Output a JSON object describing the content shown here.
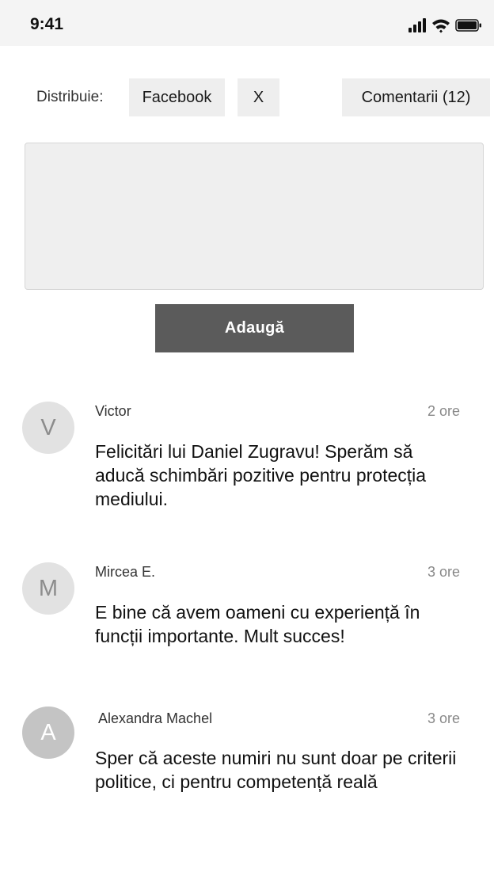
{
  "status_bar": {
    "time": "9:41",
    "icons": [
      "signal-icon",
      "wifi-icon",
      "battery-icon"
    ]
  },
  "share": {
    "label": "Distribuie:",
    "facebook": "Facebook",
    "x": "X",
    "comments": "Comentarii (12)"
  },
  "comment_form": {
    "placeholder": "",
    "submit_label": "Adaugă"
  },
  "comments": [
    {
      "initial": "V",
      "author": "Victor",
      "time": "2 ore",
      "text": "Felicitări lui Daniel Zugravu! Sperăm să aducă schimbări pozitive pentru protecția mediului."
    },
    {
      "initial": "M",
      "author": "Mircea E.",
      "time": "3 ore",
      "text": "E bine că avem oameni cu experiență în funcții importante. Mult succes!"
    },
    {
      "initial": "A",
      "author": "Alexandra Machel",
      "time": "3 ore",
      "text": "Sper că aceste numiri nu sunt doar pe criterii politice, ci pentru competență reală"
    }
  ],
  "colors": {
    "button_bg": "#eeeeee",
    "primary_button": "#5b5b5b",
    "textarea_bg": "#efefef",
    "avatar_light": "#e2e2e2",
    "avatar_dark": "#c4c4c4"
  }
}
